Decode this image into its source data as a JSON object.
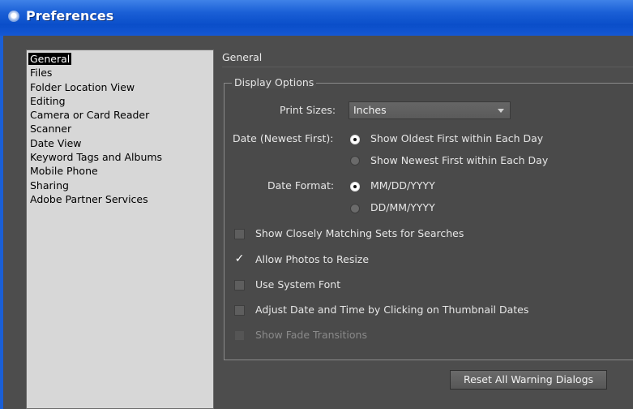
{
  "window": {
    "title": "Preferences"
  },
  "sidebar": {
    "items": [
      {
        "label": "General",
        "selected": true
      },
      {
        "label": "Files"
      },
      {
        "label": "Folder Location View"
      },
      {
        "label": "Editing"
      },
      {
        "label": "Camera or Card Reader"
      },
      {
        "label": "Scanner"
      },
      {
        "label": "Date View"
      },
      {
        "label": "Keyword Tags and Albums"
      },
      {
        "label": "Mobile Phone"
      },
      {
        "label": "Sharing"
      },
      {
        "label": "Adobe Partner Services"
      }
    ]
  },
  "main": {
    "section_title": "General",
    "display_options": {
      "legend": "Display Options",
      "print_sizes": {
        "label": "Print Sizes:",
        "value": "Inches"
      },
      "date_order": {
        "label": "Date (Newest First):",
        "options": [
          {
            "label": "Show Oldest First within Each Day",
            "checked": true
          },
          {
            "label": "Show Newest First within Each Day",
            "checked": false
          }
        ]
      },
      "date_format": {
        "label": "Date Format:",
        "options": [
          {
            "label": "MM/DD/YYYY",
            "checked": true
          },
          {
            "label": "DD/MM/YYYY",
            "checked": false
          }
        ]
      },
      "checkboxes": [
        {
          "label": "Show Closely Matching Sets for Searches",
          "checked": false,
          "enabled": true
        },
        {
          "label": "Allow Photos to Resize",
          "checked": true,
          "enabled": true
        },
        {
          "label": "Use System Font",
          "checked": false,
          "enabled": true
        },
        {
          "label": "Adjust Date and Time by Clicking on Thumbnail Dates",
          "checked": false,
          "enabled": true
        },
        {
          "label": "Show Fade Transitions",
          "checked": false,
          "enabled": false
        }
      ]
    },
    "reset_button": "Reset All Warning Dialogs"
  }
}
